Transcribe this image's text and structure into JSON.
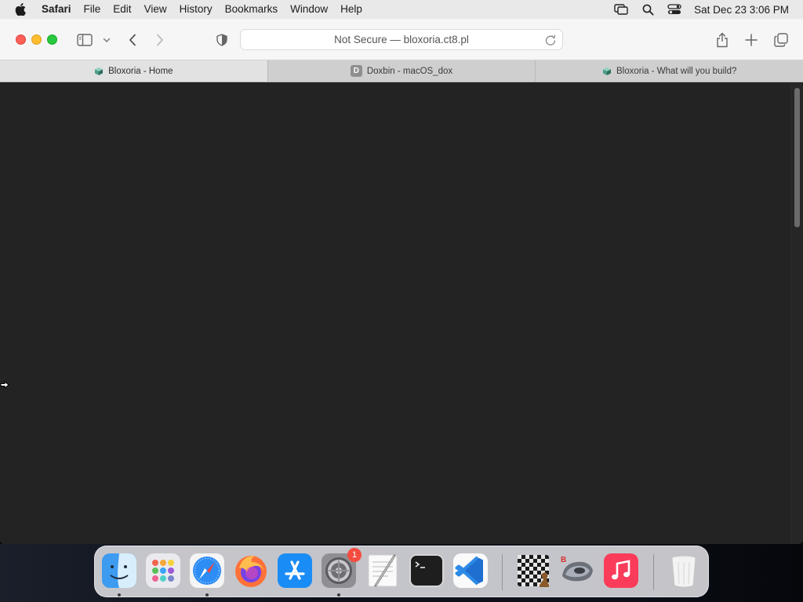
{
  "menubar": {
    "apple": "apple-logo",
    "app_name": "Safari",
    "items": [
      "File",
      "Edit",
      "View",
      "History",
      "Bookmarks",
      "Window",
      "Help"
    ],
    "clock": "Sat Dec 23  3:06 PM",
    "status_icons": [
      "screen-mirroring-icon",
      "search-icon",
      "control-center-icon"
    ]
  },
  "browser": {
    "address": "Not Secure — bloxoria.ct8.pl",
    "tabs": [
      {
        "label": "Bloxoria - Home",
        "active": true,
        "favicon": "bloxoria"
      },
      {
        "label": "Doxbin - macOS_dox",
        "active": false,
        "favicon": "D"
      },
      {
        "label": "Bloxoria - What will you build?",
        "active": false,
        "favicon": "bloxoria"
      }
    ]
  },
  "dock": {
    "apps": [
      {
        "name": "Finder",
        "running": true
      },
      {
        "name": "Launchpad",
        "running": false
      },
      {
        "name": "Safari",
        "running": true
      },
      {
        "name": "Firefox",
        "running": false
      },
      {
        "name": "App Store",
        "running": false
      },
      {
        "name": "System Settings",
        "running": true,
        "badge": "1"
      },
      {
        "name": "TextEdit",
        "running": false
      },
      {
        "name": "Terminal",
        "running": false
      },
      {
        "name": "Visual Studio Code",
        "running": false
      },
      {
        "name": "Chess",
        "running": false
      },
      {
        "name": "Roblox Studio",
        "running": false
      },
      {
        "name": "Music",
        "running": false
      },
      {
        "name": "Trash",
        "running": false
      }
    ]
  }
}
